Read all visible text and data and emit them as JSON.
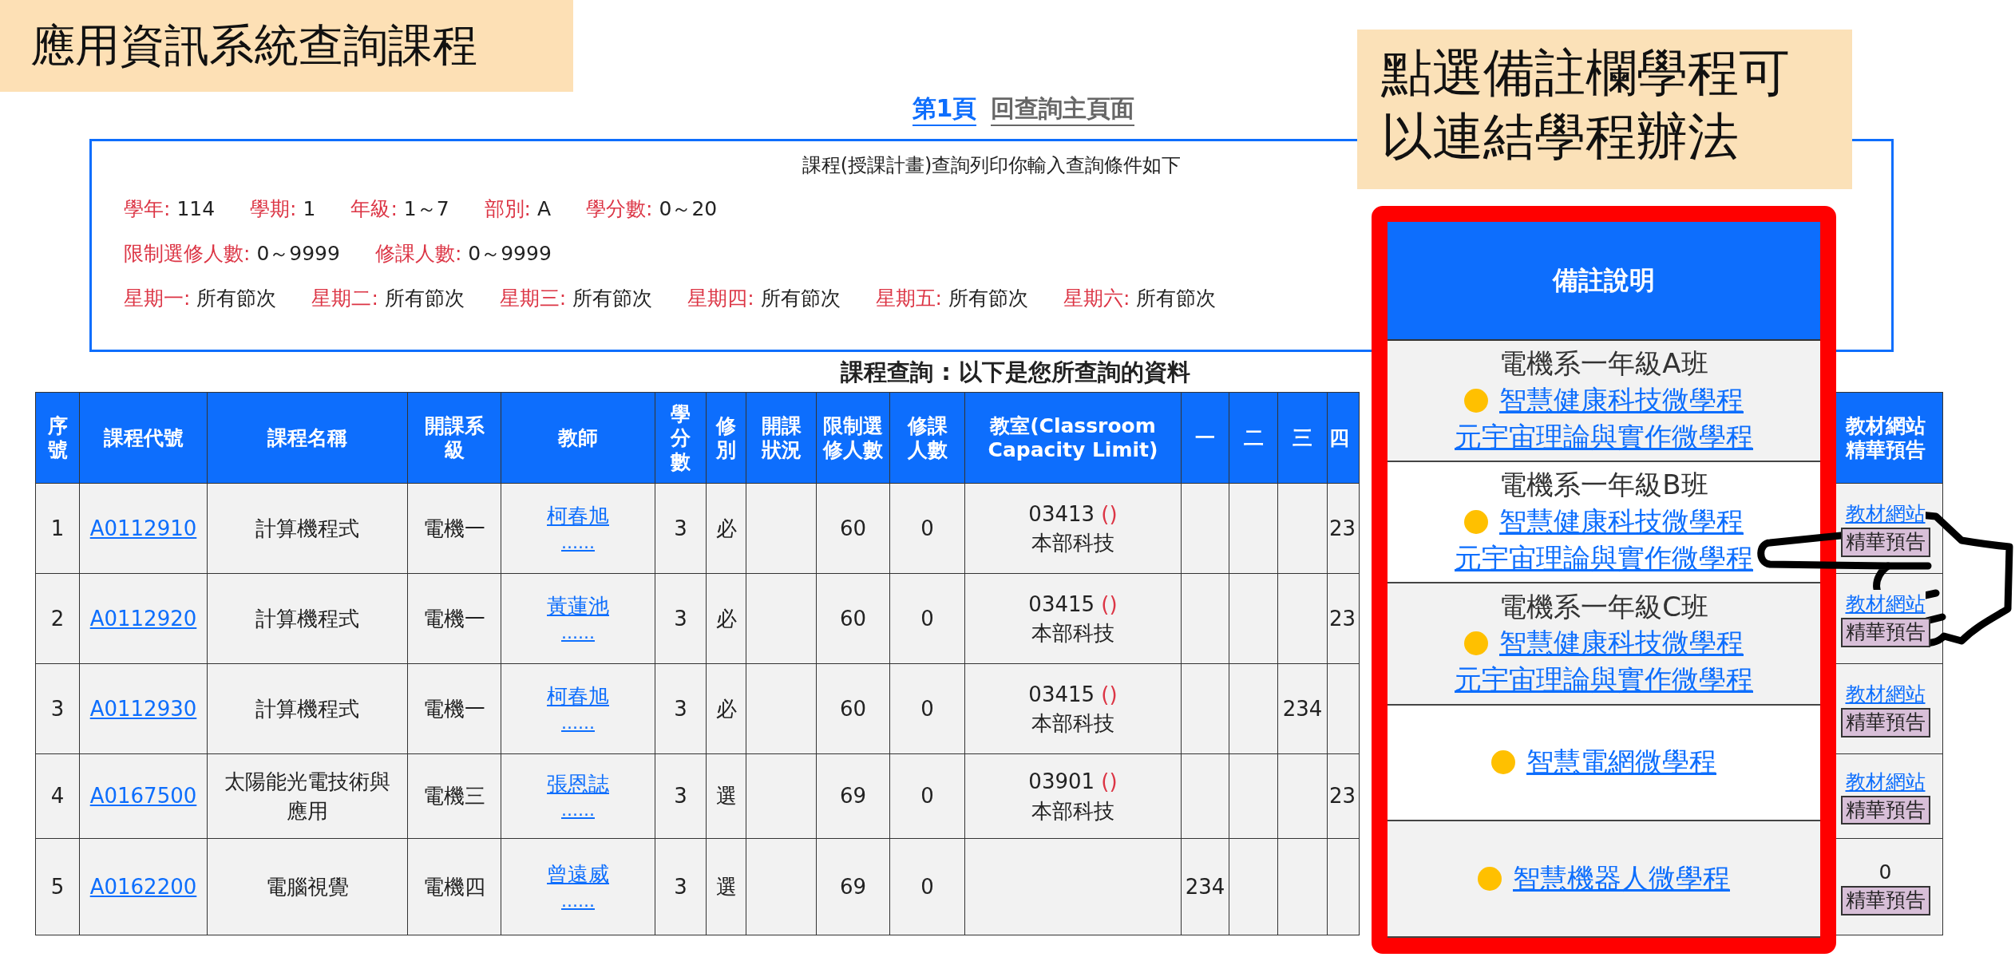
{
  "slide_title": "應用資訊系統查詢課程",
  "note": "點選備註欄學程可以連結學程辦法",
  "nav_links": [
    {
      "label": "第1頁",
      "kind": "page"
    },
    {
      "label": "回查詢主頁面",
      "kind": "home"
    }
  ],
  "criteria": {
    "title": "課程(授課計畫)查詢列印你輸入查詢條件如下",
    "lines": [
      [
        {
          "label": "學年:",
          "value": "114"
        },
        {
          "label": "學期:",
          "value": "1"
        },
        {
          "label": "年級:",
          "value": "1～7"
        },
        {
          "label": "部別:",
          "value": "A"
        },
        {
          "label": "學分數:",
          "value": "0～20"
        }
      ],
      [
        {
          "label": "限制選修人數:",
          "value": "0～9999"
        },
        {
          "label": "修課人數:",
          "value": "0～9999"
        }
      ],
      [
        {
          "label": "星期一:",
          "value": "所有節次"
        },
        {
          "label": "星期二:",
          "value": "所有節次"
        },
        {
          "label": "星期三:",
          "value": "所有節次"
        },
        {
          "label": "星期四:",
          "value": "所有節次"
        },
        {
          "label": "星期五:",
          "value": "所有節次"
        },
        {
          "label": "星期六:",
          "value": "所有節次"
        }
      ]
    ]
  },
  "result_heading": "課程查詢 : 以下是您所查詢的資料",
  "table": {
    "columns": [
      "序號",
      "課程代號",
      "課程名稱",
      "開課系級",
      "教師",
      "學分數",
      "修別",
      "開課狀況",
      "限制選修人數",
      "修課人數",
      "教室(Classroom Capacity Limit)",
      "一",
      "二",
      "三",
      "四"
    ],
    "last_column": "教材網站精華預告",
    "rows": [
      {
        "no": "1",
        "code": "A0112910",
        "name": "計算機程式",
        "dept": "電機一",
        "teacher": "柯春旭",
        "teacher_more": "......",
        "credits": "3",
        "type": "必",
        "limit": "60",
        "enrolled": "0",
        "room": {
          "code": "03413",
          "note": "()",
          "campus": "本部科技"
        },
        "periods": {
          "thu": "23"
        },
        "material": {
          "kind": "link",
          "text": "教材網站"
        },
        "preview": "精華預告"
      },
      {
        "no": "2",
        "code": "A0112920",
        "name": "計算機程式",
        "dept": "電機一",
        "teacher": "黃蓮池",
        "teacher_more": "......",
        "credits": "3",
        "type": "必",
        "limit": "60",
        "enrolled": "0",
        "room": {
          "code": "03415",
          "note": "()",
          "campus": "本部科技"
        },
        "periods": {
          "thu": "23"
        },
        "material": {
          "kind": "link",
          "text": "教材網站"
        },
        "preview": "精華預告"
      },
      {
        "no": "3",
        "code": "A0112930",
        "name": "計算機程式",
        "dept": "電機一",
        "teacher": "柯春旭",
        "teacher_more": "......",
        "credits": "3",
        "type": "必",
        "limit": "60",
        "enrolled": "0",
        "room": {
          "code": "03415",
          "note": "()",
          "campus": "本部科技"
        },
        "periods": {
          "wed": "234"
        },
        "material": {
          "kind": "link",
          "text": "教材網站"
        },
        "preview": "精華預告"
      },
      {
        "no": "4",
        "code": "A0167500",
        "name": "太陽能光電技術與應用",
        "dept": "電機三",
        "teacher": "張恩誌",
        "teacher_more": "......",
        "credits": "3",
        "type": "選",
        "limit": "69",
        "enrolled": "0",
        "room": {
          "code": "03901",
          "note": "()",
          "campus": "本部科技"
        },
        "periods": {
          "thu": "23"
        },
        "material": {
          "kind": "link",
          "text": "教材網站"
        },
        "preview": "精華預告"
      },
      {
        "no": "5",
        "code": "A0162200",
        "name": "電腦視覺",
        "dept": "電機四",
        "teacher": "曾遠威",
        "teacher_more": "......",
        "credits": "3",
        "type": "選",
        "limit": "69",
        "enrolled": "0",
        "periods": {
          "mon": "234"
        },
        "material": {
          "kind": "count",
          "text": "0"
        },
        "preview": "精華預告"
      }
    ]
  },
  "remarks": {
    "title": "備註說明",
    "rows": [
      {
        "class_label": "電機系一年級A班",
        "programs": [
          {
            "label": "智慧健康科技微學程",
            "bullet": true
          },
          {
            "label": "元宇宙理論與實作微學程",
            "bullet": false
          }
        ]
      },
      {
        "class_label": "電機系一年級B班",
        "programs": [
          {
            "label": "智慧健康科技微學程",
            "bullet": true
          },
          {
            "label": "元宇宙理論與實作微學程",
            "bullet": false
          }
        ]
      },
      {
        "class_label": "電機系一年級C班",
        "programs": [
          {
            "label": "智慧健康科技微學程",
            "bullet": true
          },
          {
            "label": "元宇宙理論與實作微學程",
            "bullet": false
          }
        ]
      },
      {
        "programs": [
          {
            "label": "智慧電網微學程",
            "bullet": true
          }
        ]
      },
      {
        "programs": [
          {
            "label": "智慧機器人微學程",
            "bullet": true
          }
        ]
      }
    ]
  }
}
